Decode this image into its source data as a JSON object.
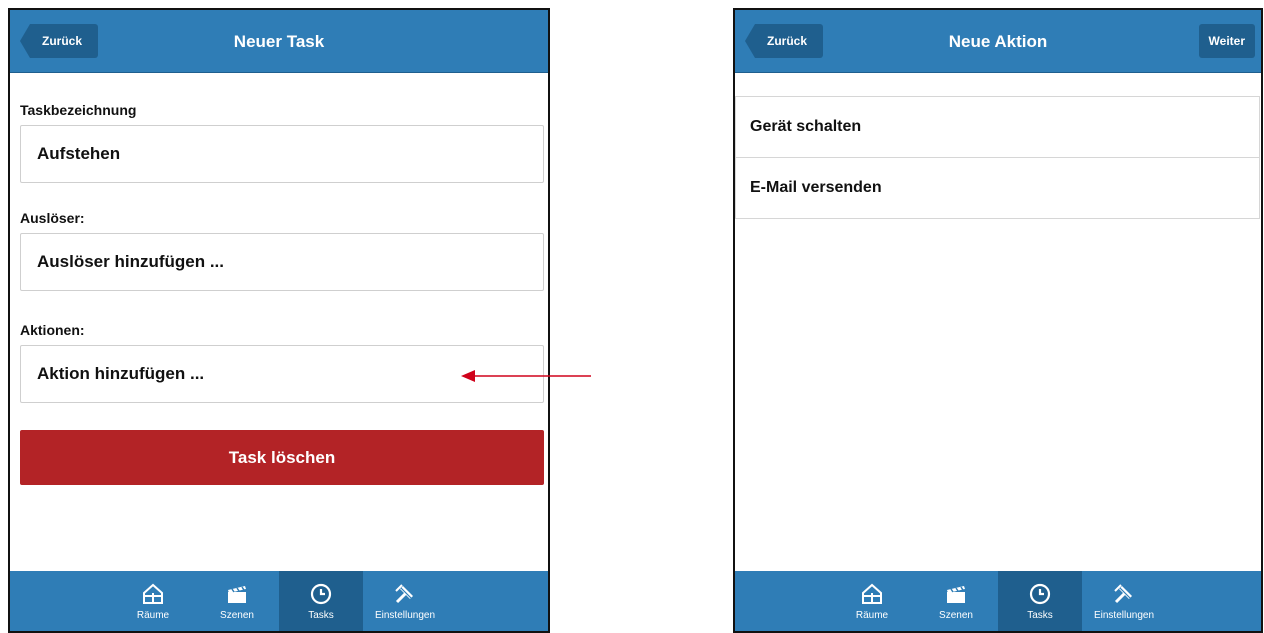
{
  "left_screen": {
    "header": {
      "back_label": "Zurück",
      "title": "Neuer Task"
    },
    "fields": {
      "taskname": {
        "label": "Taskbezeichnung",
        "value": "Aufstehen"
      },
      "trigger": {
        "label": "Auslöser:",
        "value": "Auslöser hinzufügen ..."
      },
      "actions": {
        "label": "Aktionen:",
        "value": "Aktion hinzufügen ..."
      }
    },
    "delete_label": "Task löschen"
  },
  "right_screen": {
    "header": {
      "back_label": "Zurück",
      "title": "Neue Aktion",
      "next_label": "Weiter"
    },
    "action_items": [
      "Gerät schalten",
      "E-Mail versenden"
    ]
  },
  "tabbar": {
    "items": [
      {
        "label": "Räume",
        "icon": "house-icon"
      },
      {
        "label": "Szenen",
        "icon": "clapperboard-icon"
      },
      {
        "label": "Tasks",
        "icon": "clock-icon",
        "active": true
      },
      {
        "label": "Einstellungen",
        "icon": "tools-icon"
      }
    ]
  },
  "colors": {
    "bar_blue": "#2f7db6",
    "bar_dark_blue": "#1f5f8e",
    "delete_red": "#b32326",
    "annotation_arrow": "#d0021b"
  }
}
